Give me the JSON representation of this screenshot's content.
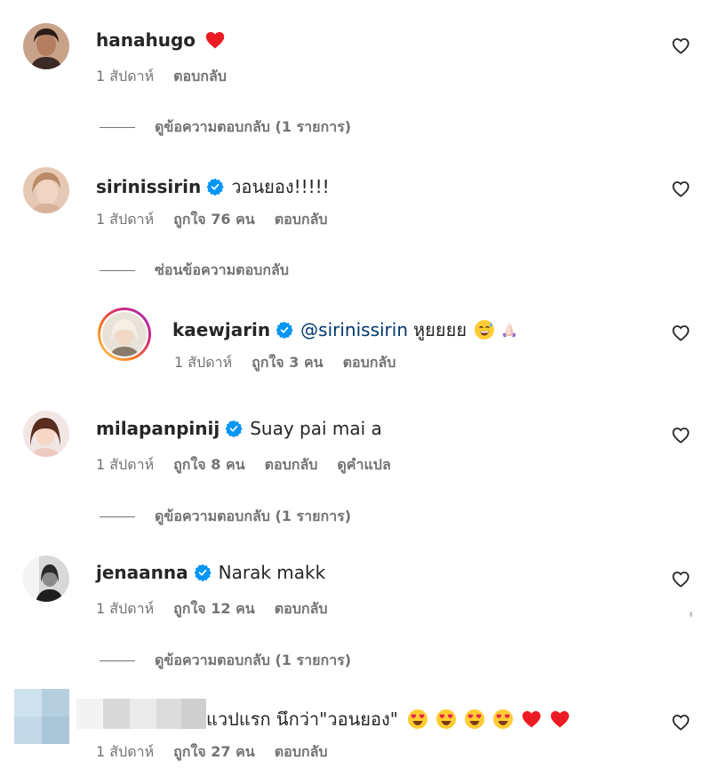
{
  "comments": [
    {
      "username": "hanahugo",
      "text": "",
      "meta": {
        "time": "1 สัปดาห์",
        "likes": "",
        "reply": "ตอบกลับ",
        "translate": ""
      },
      "replies_toggle": "ดูข้อความตอบกลับ (1 รายการ)"
    },
    {
      "username": "sirinissirin",
      "text": "วอนยอง!!!!!",
      "meta": {
        "time": "1 สัปดาห์",
        "likes": "ถูกใจ 76 คน",
        "reply": "ตอบกลับ",
        "translate": ""
      },
      "replies_toggle": "ซ่อนข้อความตอบกลับ"
    },
    {
      "username": "kaewjarin",
      "mention": "@sirinissirin",
      "text": "หูยยยย",
      "meta": {
        "time": "1 สัปดาห์",
        "likes": "ถูกใจ 3 คน",
        "reply": "ตอบกลับ",
        "translate": ""
      }
    },
    {
      "username": "milapanpinij",
      "text": "Suay pai mai a",
      "meta": {
        "time": "1 สัปดาห์",
        "likes": "ถูกใจ 8 คน",
        "reply": "ตอบกลับ",
        "translate": "ดูคำแปล"
      },
      "replies_toggle": "ดูข้อความตอบกลับ (1 รายการ)"
    },
    {
      "username": "jenaanna",
      "text": "Narak makk",
      "meta": {
        "time": "1 สัปดาห์",
        "likes": "ถูกใจ 12 คน",
        "reply": "ตอบกลับ",
        "translate": ""
      },
      "replies_toggle": "ดูข้อความตอบกลับ (1 รายการ)"
    },
    {
      "username": "",
      "text": "แวปแรก นึกว่า\"วอนยอง\"",
      "meta": {
        "time": "1 สัปดาห์",
        "likes": "ถูกใจ 27 คน",
        "reply": "ตอบกลับ",
        "translate": ""
      }
    }
  ],
  "icons": {
    "like": "heart-outline-icon",
    "verified": "verified-badge-icon",
    "red_heart": "red-heart-emoji",
    "heart_eyes": "heart-eyes-emoji",
    "smiling_sweat": "grinning-sweat-emoji",
    "pray": "pray-emoji"
  },
  "colors": {
    "text": "#262626",
    "secondary": "#737373",
    "verified": "#0095f6",
    "mention": "#00376b",
    "heart_red": "#ed1c24",
    "story_ring_start": "#feda75",
    "story_ring_end": "#d62976"
  }
}
